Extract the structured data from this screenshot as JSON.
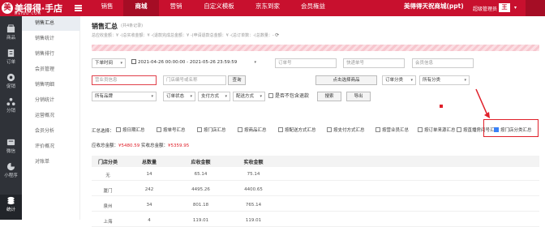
{
  "brand": {
    "logo_text": "美得得·手店",
    "logo_sub": "MEIDD.COM",
    "mark": "美"
  },
  "topnav": {
    "items": [
      "销售",
      "商城",
      "营销",
      "自定义模板",
      "京东到家",
      "会员権益"
    ],
    "active_index": 1
  },
  "user": {
    "store": "美得得天祝商城(ppt)",
    "role": "超级管理员",
    "badge": "王"
  },
  "sidebar": {
    "items": [
      {
        "label": "商品",
        "icon": "goods-icon"
      },
      {
        "label": "订单",
        "icon": "order-icon"
      },
      {
        "label": "促销",
        "icon": "promotion-icon"
      },
      {
        "label": "分销",
        "icon": "distribution-icon"
      },
      {
        "label": "微信",
        "icon": "wechat-icon"
      },
      {
        "label": "小程序",
        "icon": "miniprogram-icon"
      },
      {
        "label": "统计",
        "icon": "stats-icon"
      }
    ],
    "active_index": 6
  },
  "subnav": {
    "items": [
      "销售汇总",
      "销售统计",
      "销售排行",
      "会员管理",
      "销售明细",
      "分销统计",
      "运营概况",
      "会员分析",
      "评价概况",
      "对账单"
    ],
    "active_index": 0
  },
  "page": {
    "title": "销售汇总",
    "count": "(共4条记录)",
    "summary": "总应收金额：¥ -(总实收金额：¥ -(退款完成总金额：¥ -(申请退款总金额：¥ -(总订单数：-(总数量：-"
  },
  "filters": {
    "time_type": "下单时间",
    "date_range": "2021-04-26 00:00:00 - 2021-05-26 23:59:59",
    "order_no": "订单号",
    "express_no": "快递单号",
    "member_info": "会员信息",
    "staff_info": "营业员信息",
    "store_search": "门店编号或名称",
    "query_label": "查询",
    "select_product": "点击选择商品",
    "goods_category": "订单分类",
    "all_category": "所有分类",
    "all_brand": "所有品牌",
    "order_status": "订单状态",
    "pay_method": "支付方式",
    "delivery_method": "配送方式",
    "include_refund": "是否不包含退款",
    "search_button": "搜索",
    "export_button": "导出"
  },
  "summary_options": {
    "label": "汇总选择：",
    "items": [
      {
        "label": "按日期汇总",
        "checked": false
      },
      {
        "label": "按单号汇总",
        "checked": false
      },
      {
        "label": "按门店汇总",
        "checked": false
      },
      {
        "label": "按商品汇总",
        "checked": false
      },
      {
        "label": "按配送方式汇总",
        "checked": false
      },
      {
        "label": "按支付方式汇总",
        "checked": false
      },
      {
        "label": "按营业员汇总",
        "checked": false
      },
      {
        "label": "按订单来源汇总",
        "checked": false
      },
      {
        "label": "按直播房间号汇总",
        "checked": false
      },
      {
        "label": "按门店分类汇总",
        "checked": true
      }
    ]
  },
  "totals": {
    "received_label": "应收总金额：",
    "received": "¥5480.59",
    "actual_label": "实收总金额：",
    "actual": "¥5359.95"
  },
  "table": {
    "headers": [
      "门店分类",
      "总数量",
      "应收金额",
      "实收金额"
    ],
    "rows": [
      [
        "无",
        "14",
        "65.14",
        "75.14"
      ],
      [
        "厦门",
        "242",
        "4495.26",
        "4400.65"
      ],
      [
        "泉州",
        "34",
        "801.18",
        "765.14"
      ],
      [
        "上海",
        "4",
        "119.01",
        "119.01"
      ]
    ]
  },
  "colors": {
    "brand": "#c8102e",
    "highlight": "#e0202a",
    "sidebar": "#2f3238",
    "accent": "#3b82f6"
  }
}
